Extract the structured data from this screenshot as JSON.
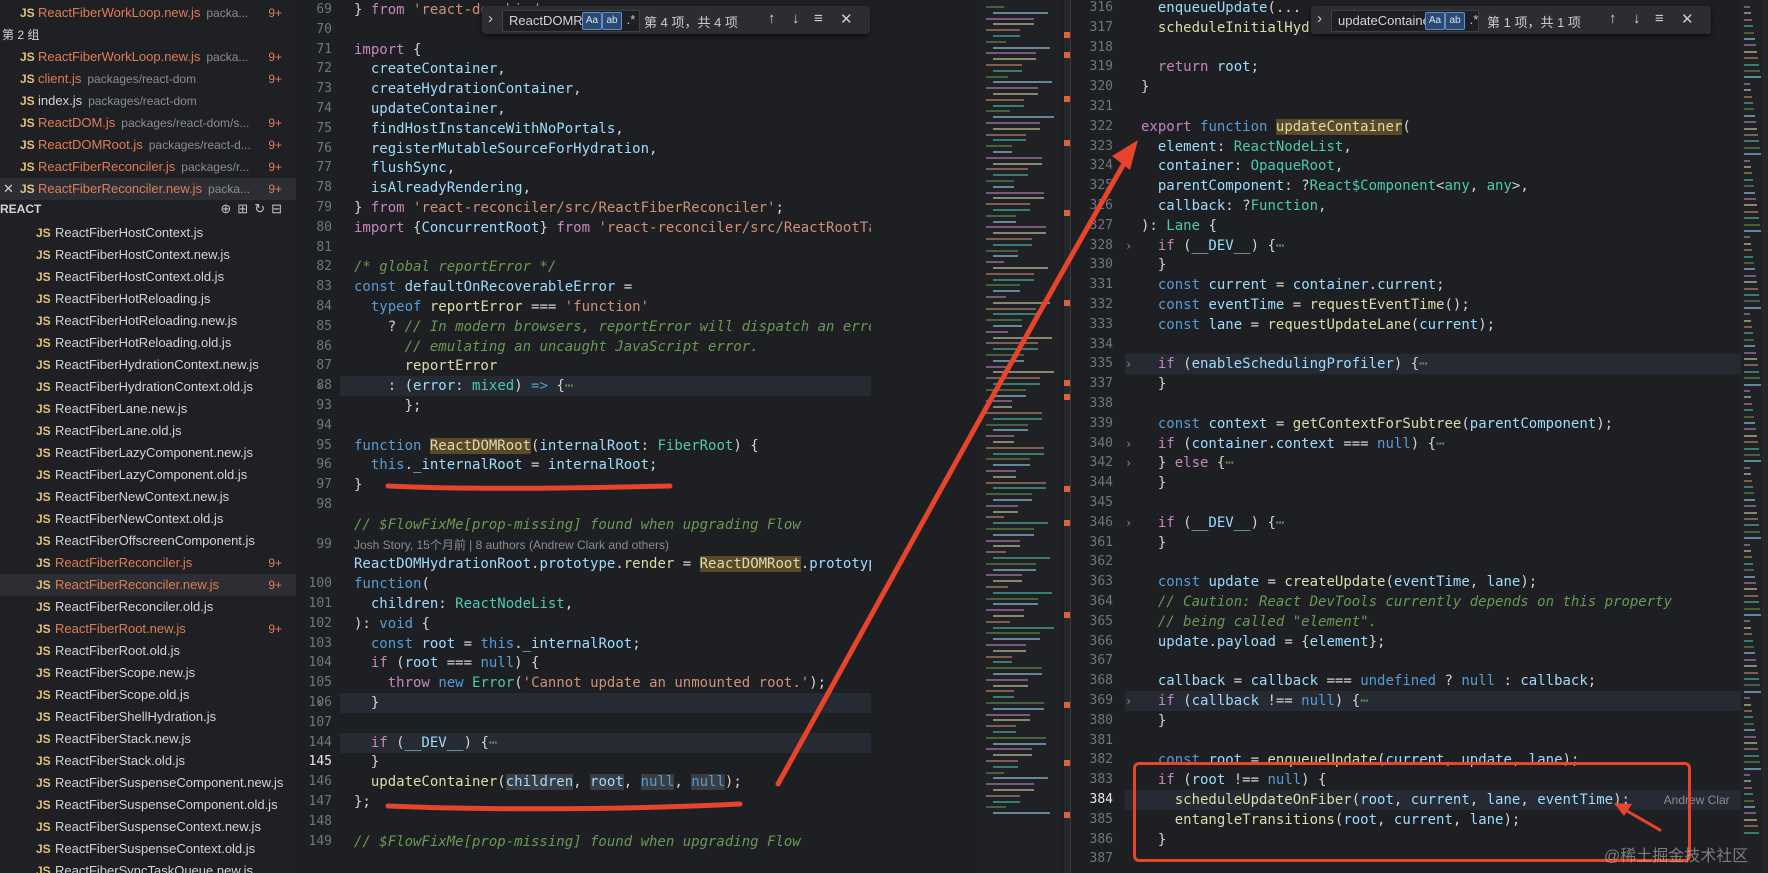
{
  "sidebar": {
    "open_editors": [
      {
        "name": "ReactFiberWorkLoop.new.js",
        "path": "packa...",
        "badge": "9+",
        "modified": true
      },
      {
        "group_label": "第 2 组"
      },
      {
        "name": "ReactFiberWorkLoop.new.js",
        "path": "packa...",
        "badge": "9+",
        "modified": true
      },
      {
        "name": "client.js",
        "path": "packages/react-dom",
        "badge": "9+",
        "modified": true
      },
      {
        "name": "index.js",
        "path": "packages/react-dom",
        "badge": "",
        "modified": false
      },
      {
        "name": "ReactDOM.js",
        "path": "packages/react-dom/s...",
        "badge": "9+",
        "modified": true
      },
      {
        "name": "ReactDOMRoot.js",
        "path": "packages/react-d...",
        "badge": "9+",
        "modified": true
      },
      {
        "name": "ReactFiberReconciler.js",
        "path": "packages/r...",
        "badge": "9+",
        "modified": true
      },
      {
        "name": "ReactFiberReconciler.new.js",
        "path": "packa...",
        "badge": "9+",
        "modified": true,
        "active": true
      }
    ],
    "explorer_title": "REACT",
    "explorer_actions": [
      "new-file-icon",
      "new-folder-icon",
      "refresh-icon",
      "collapse-icon"
    ],
    "files": [
      {
        "name": "ReactFiberHostContext.js",
        "badge": "",
        "modified": false
      },
      {
        "name": "ReactFiberHostContext.new.js",
        "badge": "",
        "modified": false
      },
      {
        "name": "ReactFiberHostContext.old.js",
        "badge": "",
        "modified": false
      },
      {
        "name": "ReactFiberHotReloading.js",
        "badge": "",
        "modified": false
      },
      {
        "name": "ReactFiberHotReloading.new.js",
        "badge": "",
        "modified": false
      },
      {
        "name": "ReactFiberHotReloading.old.js",
        "badge": "",
        "modified": false
      },
      {
        "name": "ReactFiberHydrationContext.new.js",
        "badge": "",
        "modified": false
      },
      {
        "name": "ReactFiberHydrationContext.old.js",
        "badge": "",
        "modified": false
      },
      {
        "name": "ReactFiberLane.new.js",
        "badge": "",
        "modified": false
      },
      {
        "name": "ReactFiberLane.old.js",
        "badge": "",
        "modified": false
      },
      {
        "name": "ReactFiberLazyComponent.new.js",
        "badge": "",
        "modified": false
      },
      {
        "name": "ReactFiberLazyComponent.old.js",
        "badge": "",
        "modified": false
      },
      {
        "name": "ReactFiberNewContext.new.js",
        "badge": "",
        "modified": false
      },
      {
        "name": "ReactFiberNewContext.old.js",
        "badge": "",
        "modified": false
      },
      {
        "name": "ReactFiberOffscreenComponent.js",
        "badge": "",
        "modified": false
      },
      {
        "name": "ReactFiberReconciler.js",
        "badge": "9+",
        "modified": true
      },
      {
        "name": "ReactFiberReconciler.new.js",
        "badge": "9+",
        "modified": true,
        "selected": true
      },
      {
        "name": "ReactFiberReconciler.old.js",
        "badge": "",
        "modified": false
      },
      {
        "name": "ReactFiberRoot.new.js",
        "badge": "9+",
        "modified": true
      },
      {
        "name": "ReactFiberRoot.old.js",
        "badge": "",
        "modified": false
      },
      {
        "name": "ReactFiberScope.new.js",
        "badge": "",
        "modified": false
      },
      {
        "name": "ReactFiberScope.old.js",
        "badge": "",
        "modified": false
      },
      {
        "name": "ReactFiberShellHydration.js",
        "badge": "",
        "modified": false
      },
      {
        "name": "ReactFiberStack.new.js",
        "badge": "",
        "modified": false
      },
      {
        "name": "ReactFiberStack.old.js",
        "badge": "",
        "modified": false
      },
      {
        "name": "ReactFiberSuspenseComponent.new.js",
        "badge": "",
        "modified": false
      },
      {
        "name": "ReactFiberSuspenseComponent.old.js",
        "badge": "",
        "modified": false
      },
      {
        "name": "ReactFiberSuspenseContext.new.js",
        "badge": "",
        "modified": false
      },
      {
        "name": "ReactFiberSuspenseContext.old.js",
        "badge": "",
        "modified": false
      },
      {
        "name": "ReactFiberSyncTaskQueue.new.js",
        "badge": "",
        "modified": false
      }
    ],
    "js_label": "JS"
  },
  "left_editor": {
    "find": {
      "query": "ReactDOMRoo",
      "case": "Aa",
      "word": "ab",
      "regex": ".*",
      "count": "第 4 项，共 4 项"
    },
    "line_numbers": [
      "69",
      "70",
      "71",
      "72",
      "73",
      "74",
      "75",
      "76",
      "77",
      "78",
      "79",
      "80",
      "81",
      "82",
      "83",
      "84",
      "85",
      "86",
      "87",
      "88",
      "93",
      "94",
      "95",
      "96",
      "97",
      "98",
      "",
      "99",
      "",
      "100",
      "101",
      "102",
      "103",
      "104",
      "105",
      "106",
      "107",
      "144",
      "145",
      "146",
      "147",
      "148",
      "149"
    ],
    "blame": "Josh Story, 15个月前 | 8 authors (Andrew Clark and others)"
  },
  "right_editor": {
    "find": {
      "query": "updateContainer",
      "case": "Aa",
      "word": "ab",
      "regex": ".*",
      "count": "第 1 项，共 1 项"
    },
    "line_numbers": [
      "316",
      "317",
      "318",
      "319",
      "320",
      "321",
      "322",
      "323",
      "324",
      "325",
      "326",
      "327",
      "328",
      "330",
      "331",
      "332",
      "333",
      "334",
      "335",
      "337",
      "338",
      "339",
      "340",
      "342",
      "344",
      "345",
      "346",
      "361",
      "362",
      "363",
      "364",
      "365",
      "366",
      "367",
      "368",
      "369",
      "380",
      "381",
      "382",
      "383",
      "384",
      "385",
      "386",
      "387"
    ],
    "blame_inline": "Andrew Clar",
    "watermark": "@稀土掘金技术社区"
  },
  "colors": {
    "accent": "#e8432b",
    "modified": "#e07d57"
  }
}
